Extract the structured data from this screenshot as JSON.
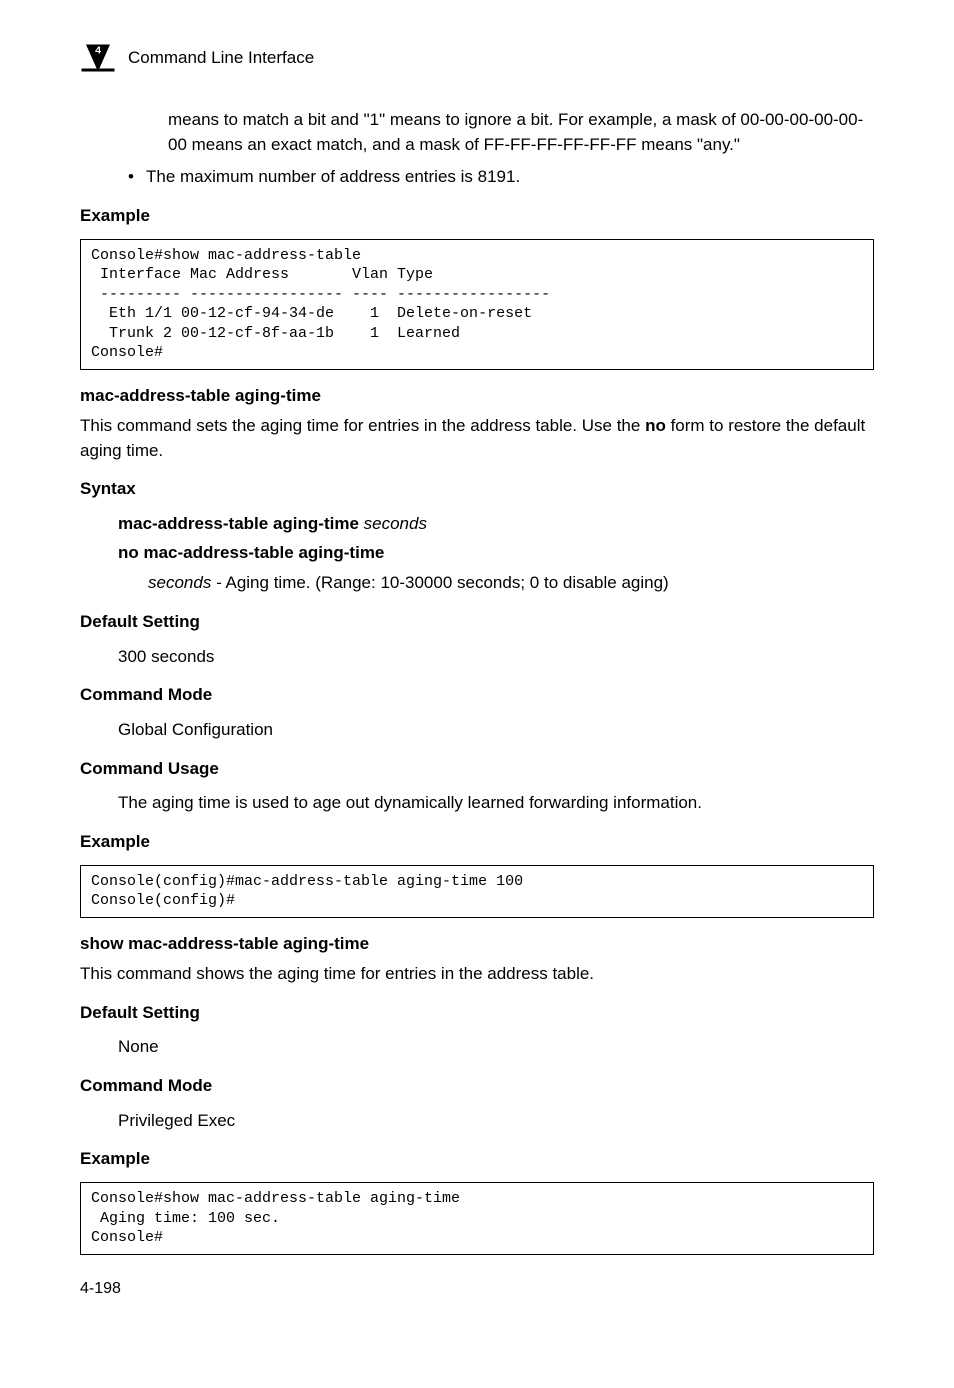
{
  "header": {
    "chapter_number": "4",
    "title": "Command Line Interface"
  },
  "intro": {
    "continuation": "means to match a bit and \"1\" means to ignore a bit. For example, a mask of 00-00-00-00-00-00 means an exact match, and a mask of FF-FF-FF-FF-FF-FF means \"any.\"",
    "bullet": "The maximum number of address entries is 8191."
  },
  "example1": {
    "heading": "Example",
    "code": "Console#show mac-address-table\n Interface Mac Address       Vlan Type\n --------- ----------------- ---- -----------------\n  Eth 1/1 00-12-cf-94-34-de    1  Delete-on-reset\n  Trunk 2 00-12-cf-8f-aa-1b    1  Learned\nConsole#"
  },
  "cmd1": {
    "title": "mac-address-table aging-time",
    "desc_a": "This command sets the aging time for entries in the address table. Use the ",
    "desc_bold": "no",
    "desc_b": " form to restore the default aging time.",
    "syntax_head": "Syntax",
    "syntax_l1a": "mac-address-table aging-time",
    "syntax_l1b": " seconds",
    "syntax_l2": "no mac-address-table aging-time",
    "syntax_arg_a": "seconds -",
    "syntax_arg_b": " Aging time. (Range: 10-30000 seconds; 0 to disable aging)",
    "default_head": "Default Setting",
    "default_val": "300 seconds",
    "mode_head": "Command Mode",
    "mode_val": "Global Configuration",
    "usage_head": "Command Usage",
    "usage_val": "The aging time is used to age out dynamically learned forwarding information.",
    "example_head": "Example",
    "example_code": "Console(config)#mac-address-table aging-time 100\nConsole(config)#"
  },
  "cmd2": {
    "title": "show mac-address-table aging-time",
    "desc": "This command shows the aging time for entries in the address table.",
    "default_head": "Default Setting",
    "default_val": "None",
    "mode_head": "Command Mode",
    "mode_val": "Privileged Exec",
    "example_head": "Example",
    "example_code": "Console#show mac-address-table aging-time\n Aging time: 100 sec.\nConsole#"
  },
  "page_number": "4-198"
}
